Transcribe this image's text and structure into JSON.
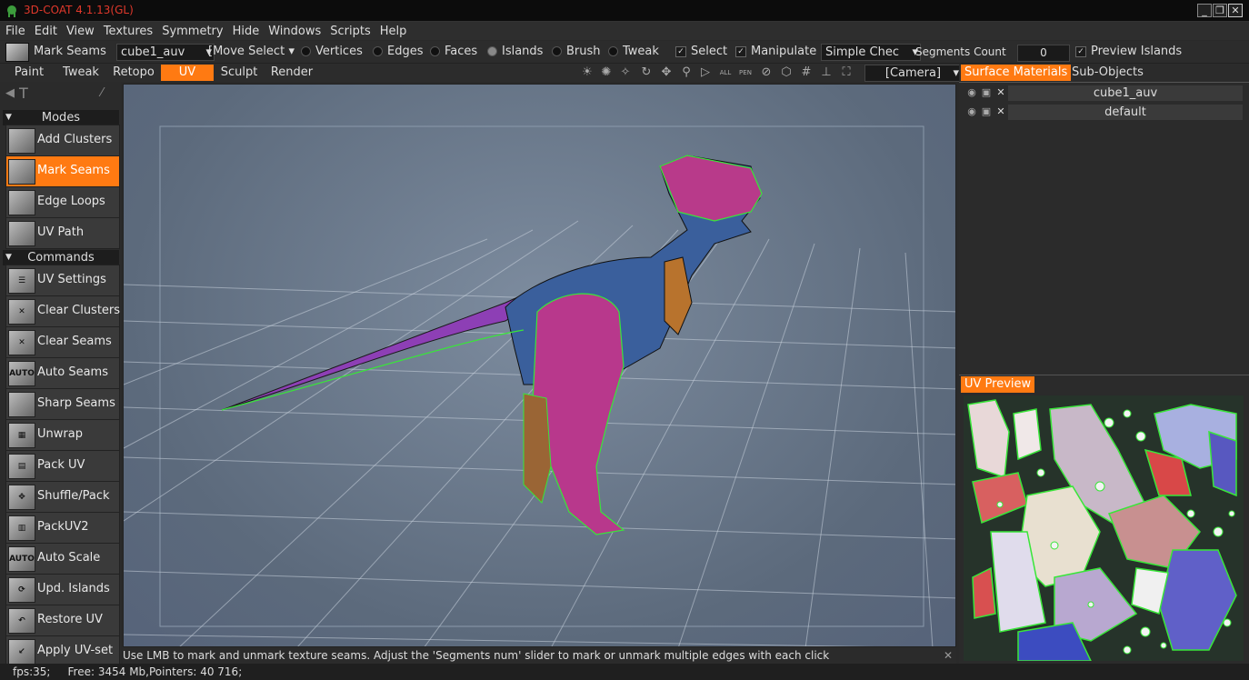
{
  "titlebar": {
    "title": "3D-COAT 4.1.13(GL)"
  },
  "menu": [
    "File",
    "Edit",
    "View",
    "Textures",
    "Symmetry",
    "Hide",
    "Windows",
    "Scripts",
    "Help"
  ],
  "toolbar": {
    "tool_name": "Mark Seams",
    "object_select": "cube1_auv",
    "mode_select": "[Move Select",
    "radios": [
      {
        "label": "Vertices",
        "checked": false
      },
      {
        "label": "Edges",
        "checked": false
      },
      {
        "label": "Faces",
        "checked": false
      },
      {
        "label": "Islands",
        "checked": true
      },
      {
        "label": "Brush",
        "checked": false
      },
      {
        "label": "Tweak",
        "checked": false
      }
    ],
    "select_label": "Select",
    "manipulate_label": "Manipulate",
    "checker_select": "Simple Chec",
    "segments_label": "Segments Count",
    "segments_value": "0",
    "preview_islands_label": "Preview Islands"
  },
  "tabs": [
    "Paint",
    "Tweak",
    "Retopo",
    "UV",
    "Sculpt",
    "Render"
  ],
  "active_tab": "UV",
  "camera_select": "[Camera]",
  "left_panel": {
    "modes_header": "Modes",
    "modes": [
      {
        "label": "Add Clusters",
        "active": false
      },
      {
        "label": "Mark Seams",
        "active": true
      },
      {
        "label": "Edge Loops",
        "active": false
      },
      {
        "label": "UV Path",
        "active": false
      }
    ],
    "commands_header": "Commands",
    "commands": [
      {
        "label": "UV Settings",
        "icon": "sliders-icon"
      },
      {
        "label": "Clear Clusters",
        "icon": "x-icon"
      },
      {
        "label": "Clear Seams",
        "icon": "x-icon"
      },
      {
        "label": "Auto Seams",
        "icon": "auto-icon"
      },
      {
        "label": "Sharp Seams",
        "icon": "cube-icon"
      },
      {
        "label": "Unwrap",
        "icon": "grid-icon"
      },
      {
        "label": "Pack UV",
        "icon": "pack-icon"
      },
      {
        "label": "Shuffle/Pack",
        "icon": "shuffle-icon"
      },
      {
        "label": "PackUV2",
        "icon": "pack2-icon"
      },
      {
        "label": "Auto Scale",
        "icon": "auto-icon"
      },
      {
        "label": "Upd. Islands",
        "icon": "refresh-icon"
      },
      {
        "label": "Restore UV",
        "icon": "restore-icon"
      },
      {
        "label": "Apply UV-set",
        "icon": "apply-icon"
      }
    ]
  },
  "right_panel": {
    "tab_surface": "Surface Materials",
    "tab_subobjects": "Sub-Objects",
    "materials": [
      "cube1_auv",
      "default"
    ],
    "uv_preview_label": "UV Preview"
  },
  "status_message": "Use LMB to mark and unmark texture seams. Adjust the 'Segments num' slider to mark or unmark multiple edges with each click",
  "status_bar": "fps:35;     Free: 3454 Mb,Pointers: 40 716;",
  "colors": {
    "accent": "#ff7a12",
    "title_red": "#e0382b",
    "seam_green": "#39e639"
  }
}
